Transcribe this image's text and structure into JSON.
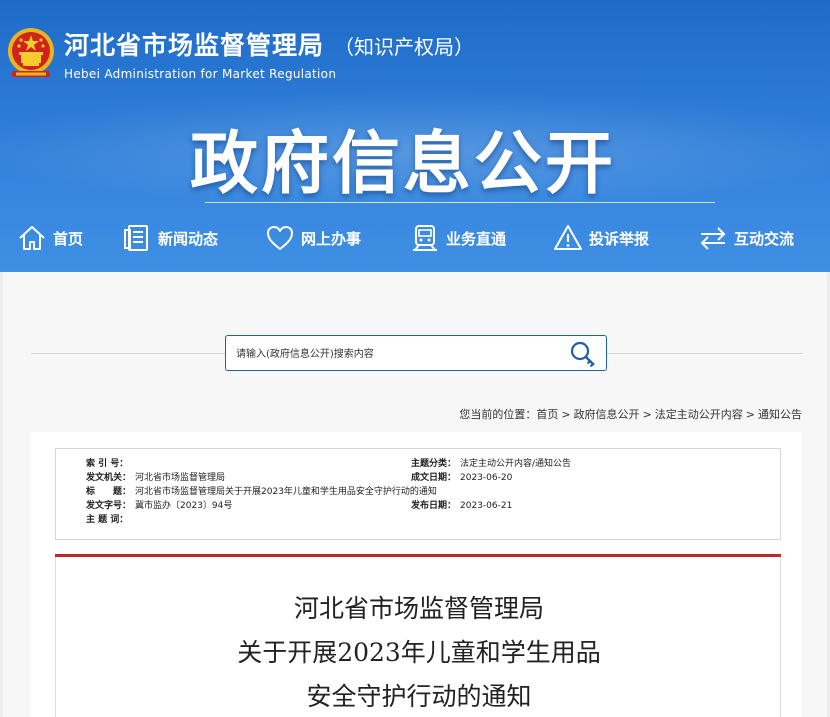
{
  "header": {
    "title": "河北省市场监督管理局",
    "subtitle": "（知识产权局）",
    "english": "Hebei Administration for Market Regulation",
    "banner": "政府信息公开"
  },
  "nav": {
    "items": [
      {
        "label": "首页",
        "icon": "home-icon"
      },
      {
        "label": "新闻动态",
        "icon": "document-list-icon"
      },
      {
        "label": "网上办事",
        "icon": "heart-icon"
      },
      {
        "label": "业务直通",
        "icon": "train-icon"
      },
      {
        "label": "投诉举报",
        "icon": "warning-icon"
      },
      {
        "label": "互动交流",
        "icon": "exchange-arrows-icon"
      }
    ]
  },
  "search": {
    "placeholder": "请输入(政府信息公开)搜索内容",
    "icon": "search-key-icon"
  },
  "breadcrumb": {
    "prefix": "您当前的位置：",
    "items": [
      "首页",
      "政府信息公开",
      "法定主动公开内容",
      "通知公告"
    ]
  },
  "meta": {
    "index_label": "索 引 号：",
    "index_value": "",
    "issuer_label": "发文机关：",
    "issuer_value": "河北省市场监督管理局",
    "title_label": "标　　题：",
    "title_value": "河北省市场监督管理局关于开展2023年儿童和学生用品安全守护行动的通知",
    "doc_no_label": "发文字号：",
    "doc_no_value": "冀市监办〔2023〕94号",
    "keywords_label": "主 题 词：",
    "keywords_value": "",
    "category_label": "主题分类：",
    "category_value": "法定主动公开内容/通知公告",
    "created_label": "成文日期：",
    "created_value": "2023-06-20",
    "published_label": "发布日期：",
    "published_value": "2023-06-21"
  },
  "article": {
    "title_lines": [
      "河北省市场监督管理局",
      "关于开展2023年儿童和学生用品",
      "安全守护行动的通知"
    ]
  },
  "colors": {
    "header_blue": "#2b7ad6",
    "search_border": "#1f5ea8",
    "article_rule_red": "#c0272d"
  }
}
